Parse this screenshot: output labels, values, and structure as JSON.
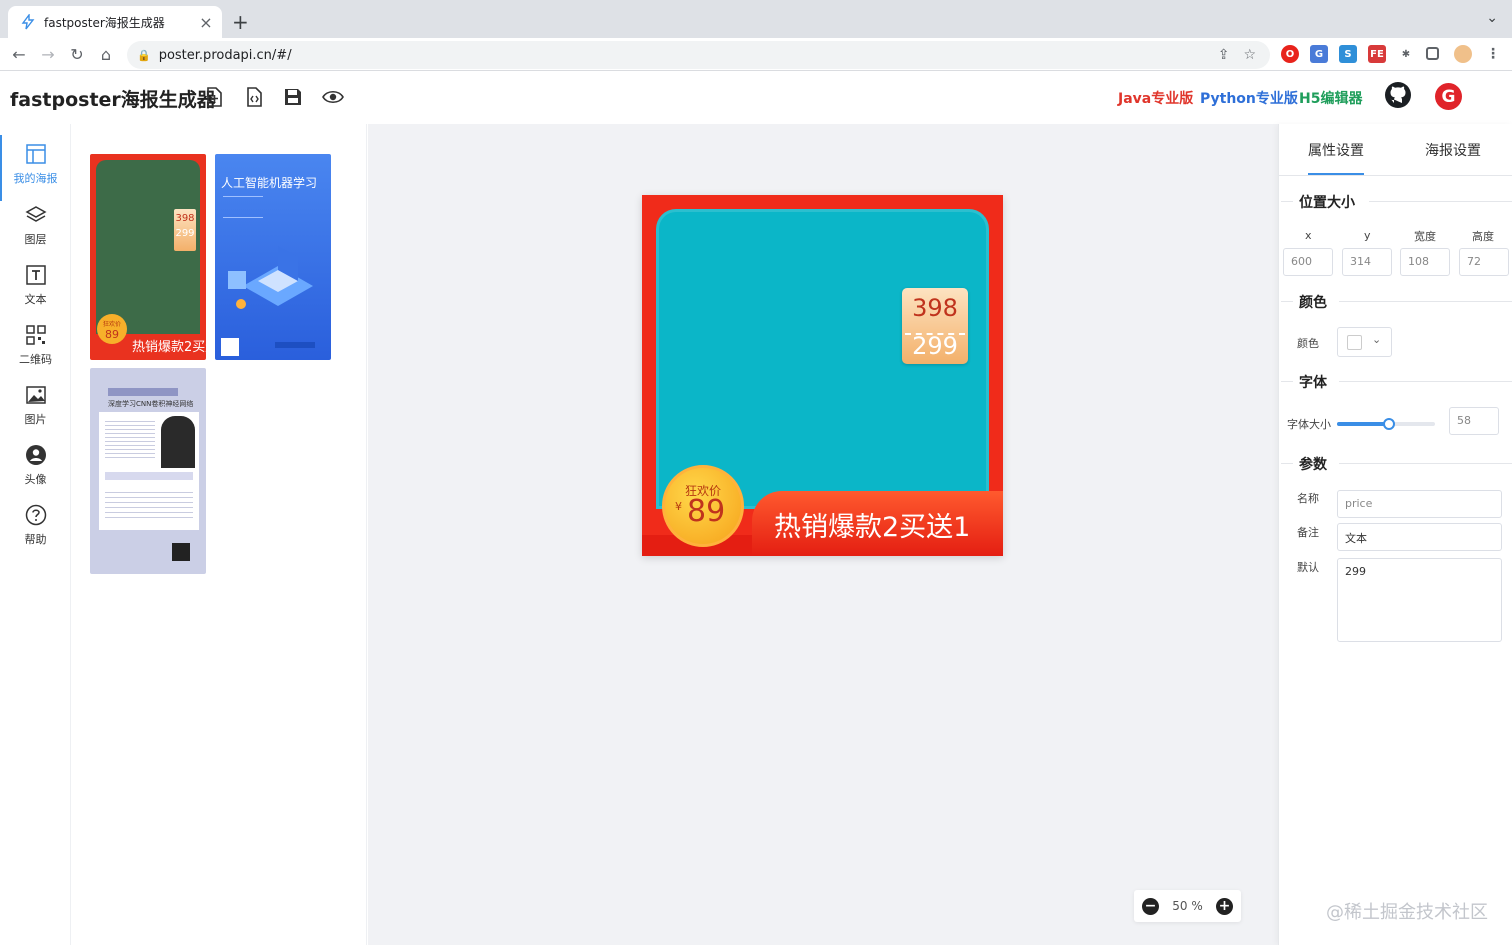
{
  "browser": {
    "tab_title": "fastposter海报生成器",
    "url": "poster.prodapi.cn/#/"
  },
  "header": {
    "app_title": "fastposter海报生成器",
    "links": [
      {
        "label": "Java专业版",
        "color": "#e0352b"
      },
      {
        "label": "Python专业版",
        "color": "#2e6fd8"
      },
      {
        "label": "H5编辑器",
        "color": "#1f9e5b"
      }
    ]
  },
  "sidebar": {
    "items": [
      {
        "label": "我的海报",
        "icon": "layout-icon"
      },
      {
        "label": "图层",
        "icon": "layers-icon"
      },
      {
        "label": "文本",
        "icon": "text-icon"
      },
      {
        "label": "二维码",
        "icon": "qrcode-icon"
      },
      {
        "label": "图片",
        "icon": "image-icon"
      },
      {
        "label": "头像",
        "icon": "avatar-icon"
      },
      {
        "label": "帮助",
        "icon": "help-icon"
      }
    ]
  },
  "posters": {
    "thumb1": {
      "price_old": "398",
      "price_new": "299",
      "price_label": "狂欢价",
      "price": "89",
      "banner": "热销爆款2买送1"
    },
    "thumb2": {
      "title": "人工智能机器学习"
    },
    "thumb3": {
      "title": "深度学习CNN卷积神经网络"
    }
  },
  "canvas": {
    "price_old": "398",
    "price_new": "299",
    "coin_label": "狂欢价",
    "currency": "¥",
    "coin_price": "89",
    "banner": "热销爆款2买送1",
    "zoom": "50 %"
  },
  "panel": {
    "tabs": [
      "属性设置",
      "海报设置"
    ],
    "sections": {
      "position": "位置大小",
      "color": "颜色",
      "font": "字体",
      "params": "参数"
    },
    "position_fields": [
      {
        "label": "x",
        "value": "600"
      },
      {
        "label": "y",
        "value": "314"
      },
      {
        "label": "宽度",
        "value": "108"
      },
      {
        "label": "高度",
        "value": "72"
      }
    ],
    "color_label": "颜色",
    "font_size_label": "字体大小",
    "font_size_value": "58",
    "font_size_fraction": 0.53,
    "name_label": "名称",
    "name_value": "price",
    "note_label": "备注",
    "note_value": "文本",
    "default_label": "默认",
    "default_value": "299"
  },
  "watermark": "@稀土掘金技术社区"
}
